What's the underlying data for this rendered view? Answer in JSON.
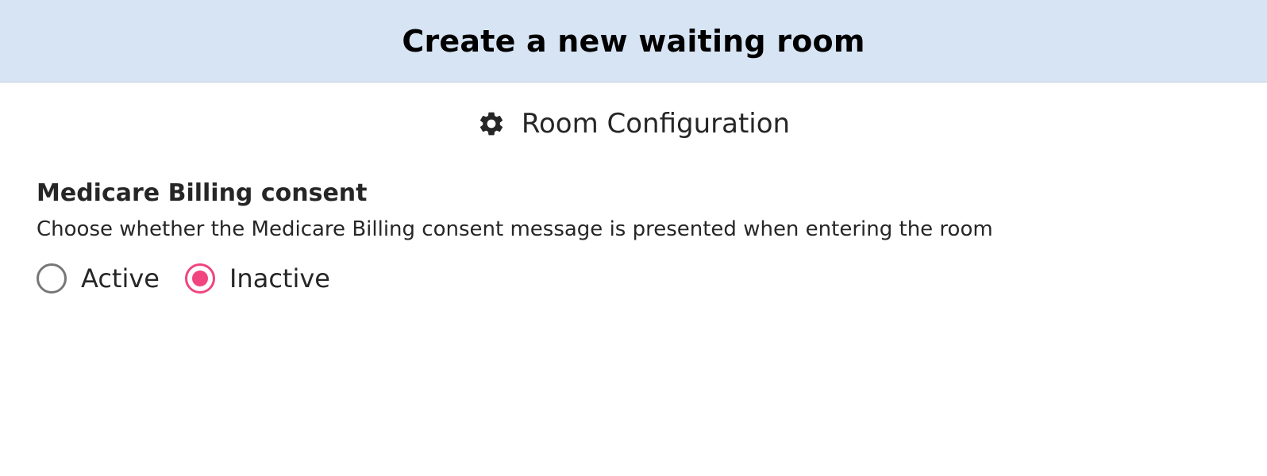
{
  "header": {
    "title": "Create a new waiting room"
  },
  "section": {
    "icon": "gear-icon",
    "title": "Room Configuration"
  },
  "setting": {
    "title": "Medicare Billing consent",
    "description": "Choose whether the Medicare Billing consent message is presented when entering the room",
    "options": [
      {
        "label": "Active",
        "selected": false
      },
      {
        "label": "Inactive",
        "selected": true
      }
    ]
  },
  "colors": {
    "header_bg": "#d7e4f3",
    "accent": "#f0457e",
    "radio_unselected": "#777777"
  }
}
